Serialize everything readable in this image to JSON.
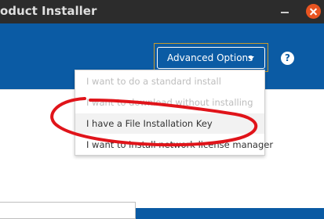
{
  "window": {
    "title": "duct Installer",
    "title_visible": "oduct Installer"
  },
  "toolbar": {
    "advanced_options_label": "Advanced Options",
    "help_label": "?"
  },
  "menu": {
    "items": [
      {
        "label": "I want to do a standard install",
        "enabled": false
      },
      {
        "label": "I want to download without installing",
        "enabled": false
      },
      {
        "label": "I have a File Installation Key",
        "enabled": true
      },
      {
        "label": "I want to install network license manager",
        "enabled": true
      }
    ]
  },
  "colors": {
    "header_blue": "#0b5ba4",
    "titlebar": "#2c2c2c",
    "close_button": "#e95420",
    "focus_outline": "#c79a2c",
    "annotation_red": "#e0141a"
  },
  "icons": {
    "help": "question-circle-icon",
    "caret": "caret-down-icon",
    "close": "close-icon",
    "minimize": "minimize-icon"
  }
}
